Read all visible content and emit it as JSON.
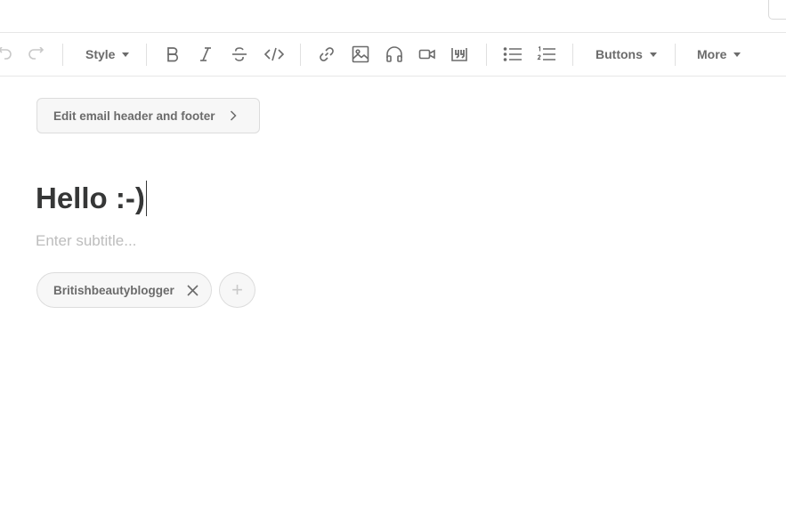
{
  "toolbar": {
    "undo": "undo-icon",
    "redo": "redo-icon",
    "style_label": "Style",
    "icons": [
      "bold-icon",
      "italic-icon",
      "strikethrough-icon",
      "code-icon",
      "link-icon",
      "image-icon",
      "audio-icon",
      "video-icon",
      "blockquote-icon",
      "bulleted-list-icon",
      "numbered-list-icon"
    ],
    "buttons_label": "Buttons",
    "more_label": "More"
  },
  "editor": {
    "header_footer_label": "Edit email header and footer",
    "title": "Hello :-)",
    "subtitle_placeholder": "Enter subtitle...",
    "tags": [
      "Britishbeautyblogger"
    ],
    "add_tag": "+"
  }
}
